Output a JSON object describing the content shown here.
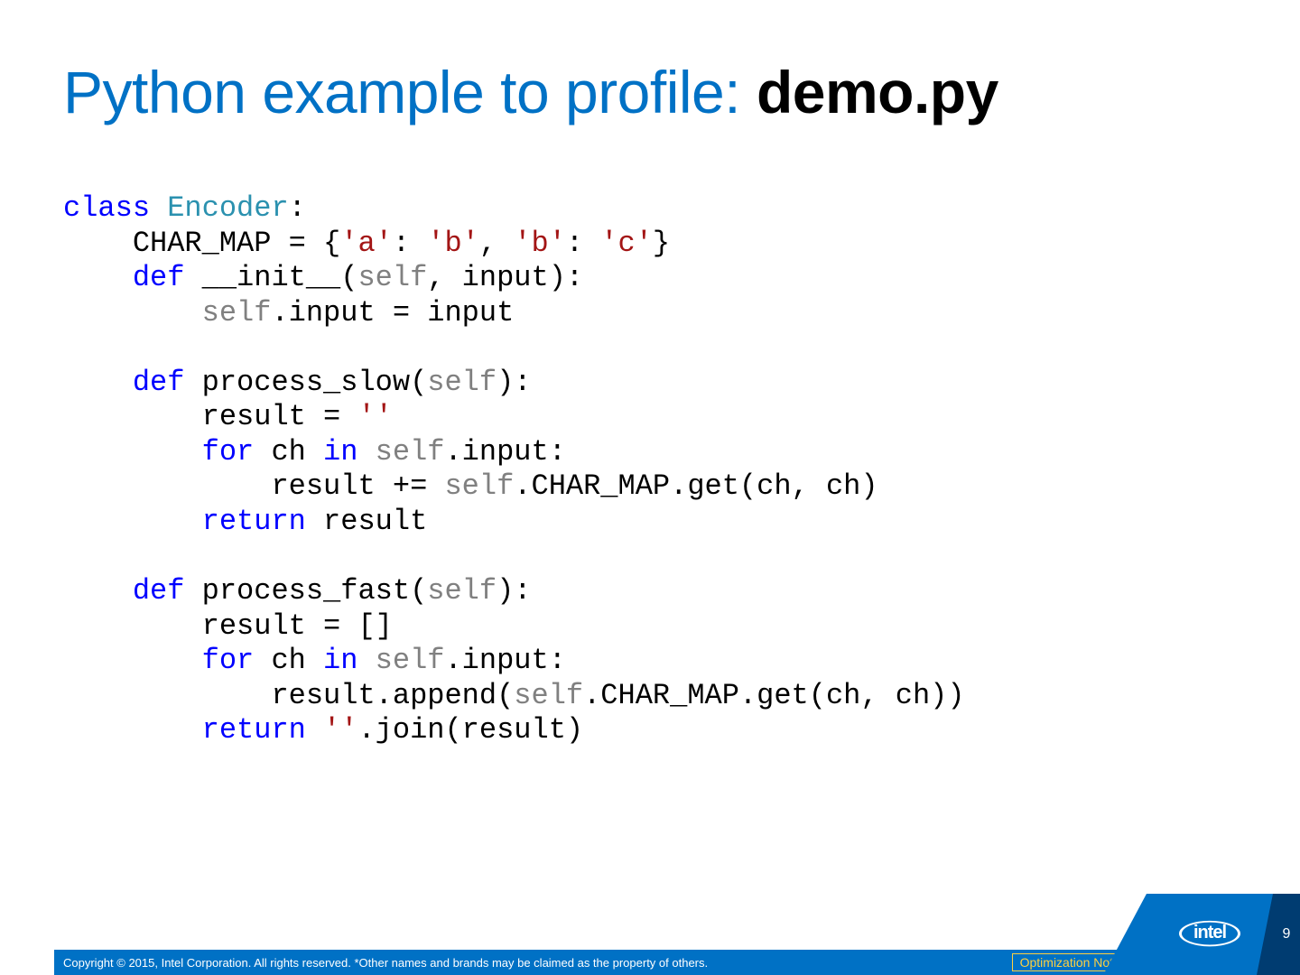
{
  "title": {
    "prefix": "Python example to profile: ",
    "bold": "demo.py"
  },
  "code": {
    "tokens": [
      [
        [
          "kw",
          "class"
        ],
        [
          "id",
          " "
        ],
        [
          "cls",
          "Encoder"
        ],
        [
          "id",
          ":"
        ]
      ],
      [
        [
          "id",
          "    CHAR_MAP = {"
        ],
        [
          "str",
          "'a'"
        ],
        [
          "id",
          ": "
        ],
        [
          "str",
          "'b'"
        ],
        [
          "id",
          ", "
        ],
        [
          "str",
          "'b'"
        ],
        [
          "id",
          ": "
        ],
        [
          "str",
          "'c'"
        ],
        [
          "id",
          "}"
        ]
      ],
      [
        [
          "id",
          "    "
        ],
        [
          "kw",
          "def"
        ],
        [
          "id",
          " __init__("
        ],
        [
          "self",
          "self"
        ],
        [
          "id",
          ", input):"
        ]
      ],
      [
        [
          "id",
          "        "
        ],
        [
          "self",
          "self"
        ],
        [
          "id",
          ".input = input"
        ]
      ],
      [
        [
          "id",
          ""
        ]
      ],
      [
        [
          "id",
          "    "
        ],
        [
          "kw",
          "def"
        ],
        [
          "id",
          " process_slow("
        ],
        [
          "self",
          "self"
        ],
        [
          "id",
          "):"
        ]
      ],
      [
        [
          "id",
          "        result = "
        ],
        [
          "str",
          "''"
        ]
      ],
      [
        [
          "id",
          "        "
        ],
        [
          "kw",
          "for"
        ],
        [
          "id",
          " ch "
        ],
        [
          "kw",
          "in"
        ],
        [
          "id",
          " "
        ],
        [
          "self",
          "self"
        ],
        [
          "id",
          ".input:"
        ]
      ],
      [
        [
          "id",
          "            result += "
        ],
        [
          "self",
          "self"
        ],
        [
          "id",
          ".CHAR_MAP.get(ch, ch)"
        ]
      ],
      [
        [
          "id",
          "        "
        ],
        [
          "kw",
          "return"
        ],
        [
          "id",
          " result"
        ]
      ],
      [
        [
          "id",
          ""
        ]
      ],
      [
        [
          "id",
          "    "
        ],
        [
          "kw",
          "def"
        ],
        [
          "id",
          " process_fast("
        ],
        [
          "self",
          "self"
        ],
        [
          "id",
          "):"
        ]
      ],
      [
        [
          "id",
          "        result = []"
        ]
      ],
      [
        [
          "id",
          "        "
        ],
        [
          "kw",
          "for"
        ],
        [
          "id",
          " ch "
        ],
        [
          "kw",
          "in"
        ],
        [
          "id",
          " "
        ],
        [
          "self",
          "self"
        ],
        [
          "id",
          ".input:"
        ]
      ],
      [
        [
          "id",
          "            result.append("
        ],
        [
          "self",
          "self"
        ],
        [
          "id",
          ".CHAR_MAP.get(ch, ch))"
        ]
      ],
      [
        [
          "id",
          "        "
        ],
        [
          "kw",
          "return"
        ],
        [
          "id",
          " "
        ],
        [
          "str",
          "''"
        ],
        [
          "id",
          ".join(result)"
        ]
      ]
    ]
  },
  "footer": {
    "copyright": "Copyright ©  2015, Intel Corporation. All rights reserved. *Other names and brands may be claimed as the property of others.",
    "optimization_notice": "Optimization Notice",
    "logo_text": "intel",
    "page_number": "9"
  },
  "colors": {
    "intel_blue": "#0071c5",
    "intel_dark": "#003c71",
    "notice_gold": "#ffd040"
  }
}
